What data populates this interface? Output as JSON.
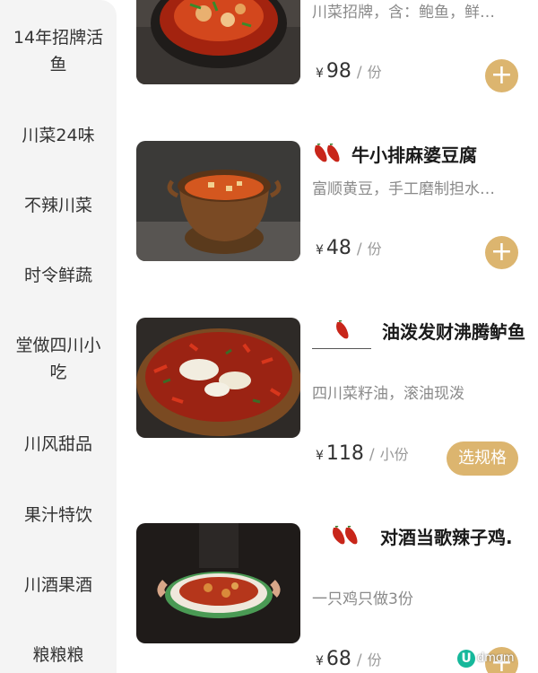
{
  "sidebar": {
    "categories": [
      {
        "label": "14年招牌活鱼"
      },
      {
        "label": "川菜24味"
      },
      {
        "label": "不辣川菜"
      },
      {
        "label": "时令鲜蔬"
      },
      {
        "label": "堂做四川小吃"
      },
      {
        "label": "川风甜品"
      },
      {
        "label": "果汁特饮"
      },
      {
        "label": "川酒果酒"
      },
      {
        "label": "粮粮粮"
      }
    ]
  },
  "items": [
    {
      "desc": "川菜招牌，含：鲍鱼，鲜…",
      "currency": "¥",
      "price": "98",
      "unit": "份",
      "button": "+"
    },
    {
      "title": "牛小排麻婆豆腐",
      "spice_level": 2,
      "desc": "富顺黄豆，手工磨制担水…",
      "currency": "¥",
      "price": "48",
      "unit": "份",
      "button": "+"
    },
    {
      "title": "油泼发财沸腾鲈鱼",
      "spice_level": 1,
      "desc": "四川菜籽油，滚油现泼",
      "currency": "¥",
      "price": "118",
      "unit": "小份",
      "button": "选规格"
    },
    {
      "title": "对酒当歌辣子鸡.",
      "spice_level": 2,
      "desc": "一只鸡只做3份",
      "currency": "¥",
      "price": "68",
      "unit": "份",
      "button": "+"
    }
  ],
  "icons": {
    "chili": "chili-pepper-icon",
    "add": "plus-icon"
  },
  "colors": {
    "accent": "#dcb56f",
    "chili": "#c8261a",
    "sidebar_bg": "#f4f4f4"
  },
  "watermark": {
    "badge": "U",
    "text": "dmom"
  }
}
